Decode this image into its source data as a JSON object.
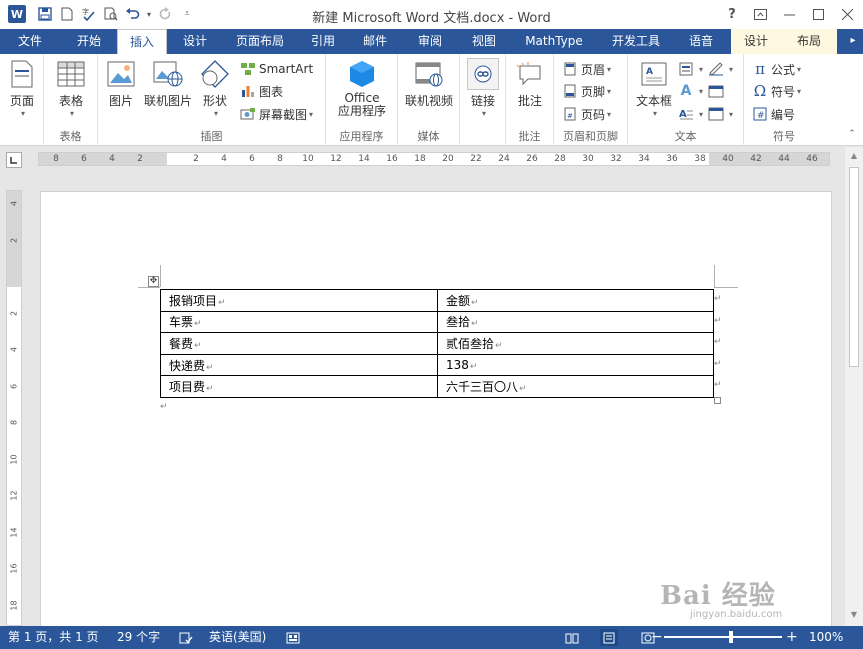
{
  "title_bar": {
    "app_icon": "W",
    "document_title": "新建 Microsoft Word 文档.docx - Word",
    "help": "?",
    "quick_access": [
      "save-icon",
      "new-document-icon",
      "spelling-icon",
      "print-preview-icon",
      "undo-icon",
      "redo-icon",
      "customize-icon"
    ]
  },
  "tabs": [
    {
      "label": "文件"
    },
    {
      "label": "开始"
    },
    {
      "label": "插入"
    },
    {
      "label": "设计"
    },
    {
      "label": "页面布局"
    },
    {
      "label": "引用"
    },
    {
      "label": "邮件"
    },
    {
      "label": "审阅"
    },
    {
      "label": "视图"
    },
    {
      "label": "MathType"
    },
    {
      "label": "开发工具"
    },
    {
      "label": "语音"
    },
    {
      "label": "设计"
    },
    {
      "label": "布局"
    }
  ],
  "ribbon": {
    "groups": {
      "pages": {
        "button": "页面"
      },
      "tables": {
        "button": "表格",
        "label": "表格"
      },
      "illustrations": {
        "label": "插图",
        "picture": "图片",
        "online_picture": "联机图片",
        "shapes": "形状",
        "smartart": "SmartArt",
        "chart": "图表",
        "screenshot": "屏幕截图"
      },
      "apps": {
        "button_line1": "Office",
        "button_line2": "应用程序",
        "label": "应用程序"
      },
      "media": {
        "button": "联机视频",
        "label": "媒体"
      },
      "links": {
        "button": "链接"
      },
      "comments": {
        "button": "批注",
        "label": "批注"
      },
      "header_footer": {
        "header": "页眉",
        "footer": "页脚",
        "page_number": "页码",
        "label": "页眉和页脚"
      },
      "text": {
        "textbox": "文本框",
        "label": "文本"
      },
      "symbols": {
        "equation": "公式",
        "symbol": "符号",
        "numbering": "编号",
        "label": "符号"
      }
    }
  },
  "ruler": {
    "horizontal_ticks": [
      "8",
      "6",
      "4",
      "2",
      "",
      "2",
      "4",
      "6",
      "8",
      "10",
      "12",
      "14",
      "16",
      "18",
      "20",
      "22",
      "24",
      "26",
      "28",
      "30",
      "32",
      "34",
      "36",
      "38",
      "40",
      "42",
      "44",
      "46"
    ],
    "vertical_ticks": [
      "4",
      "2",
      "",
      "2",
      "4",
      "6",
      "8",
      "10",
      "12",
      "14",
      "16",
      "18"
    ]
  },
  "document": {
    "table": [
      [
        "报销项目",
        "金额"
      ],
      [
        "车票",
        "叁拾"
      ],
      [
        "餐费",
        "贰佰叁拾"
      ],
      [
        "快递费",
        "138"
      ],
      [
        "项目费",
        "六千三百〇八"
      ]
    ],
    "paragraph_mark": "↵"
  },
  "status_bar": {
    "page": "第 1 页，共 1 页",
    "word_count": "29 个字",
    "language": "英语(美国)",
    "zoom": "100%",
    "zoom_minus": "−",
    "zoom_plus": "+",
    "zoom_fraction": 0.57
  },
  "watermark": {
    "brand": "Bai 经验",
    "url": "jingyan.baidu.com"
  },
  "colors": {
    "accent": "#2b579a",
    "contextual_tab": "#fff8e1"
  }
}
